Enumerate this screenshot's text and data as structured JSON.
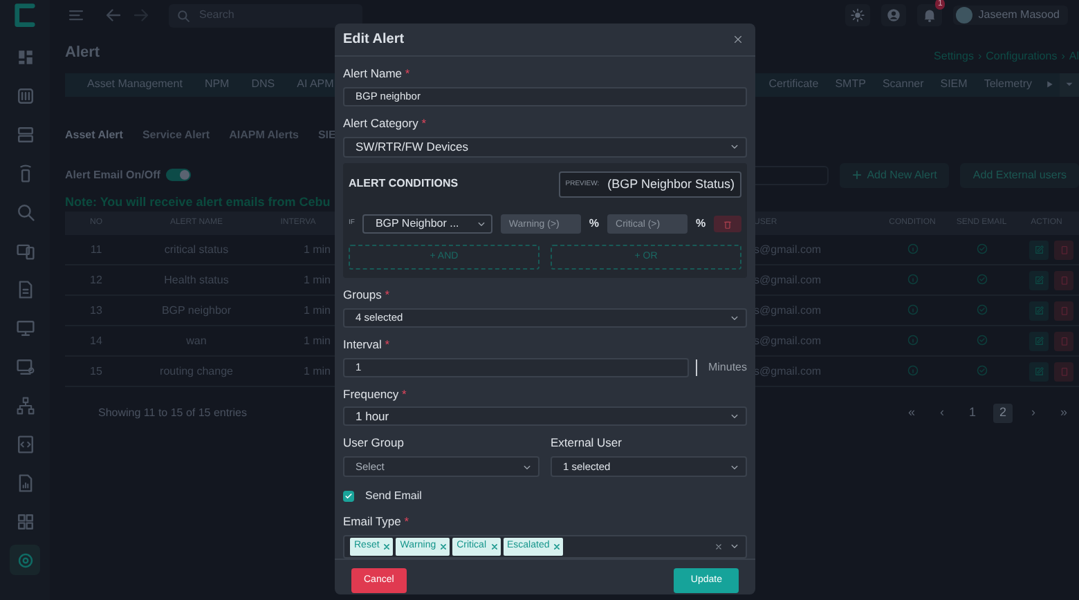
{
  "topbar": {
    "search": {
      "placeholder": "Search"
    },
    "notification_count": "1",
    "user_name": "Jaseem Masood"
  },
  "sidebar": {
    "items": [
      {
        "selected": false
      },
      {
        "selected": false
      },
      {
        "selected": false
      },
      {
        "selected": false
      },
      {
        "selected": false
      },
      {
        "selected": false
      },
      {
        "selected": false
      },
      {
        "selected": false
      },
      {
        "selected": false
      },
      {
        "selected": false
      },
      {
        "selected": false
      },
      {
        "selected": false
      },
      {
        "selected": false
      },
      {
        "selected": true
      }
    ]
  },
  "page": {
    "title": "Alert",
    "breadcrumb": [
      "Settings",
      "›",
      "Configurations",
      "›",
      "Al"
    ]
  },
  "module_tabs": {
    "left": [
      {
        "label": "Asset Management",
        "selected": false
      },
      {
        "label": "NPM",
        "selected": false
      },
      {
        "label": "DNS",
        "selected": false
      },
      {
        "label": "AI APM",
        "selected": false
      }
    ],
    "right": [
      {
        "label": "Certificate",
        "selected": false
      },
      {
        "label": "SMTP",
        "selected": false
      },
      {
        "label": "Scanner",
        "selected": false
      },
      {
        "label": "SIEM",
        "selected": false
      },
      {
        "label": "Telemetry",
        "selected": false
      }
    ]
  },
  "alert_tabs": [
    {
      "label": "Asset Alert",
      "selected": true
    },
    {
      "label": "Service Alert",
      "selected": false
    },
    {
      "label": "AIAPM Alerts",
      "selected": false
    },
    {
      "label": "SIE",
      "selected": false
    }
  ],
  "email_toggle": {
    "label": "Alert Email On/Off",
    "on": true
  },
  "buttons": [
    "Add New Alert",
    "Add External users"
  ],
  "note": "Note: You will receive alert emails from Cebu",
  "table": {
    "columns": [
      "NO",
      "ALERT NAME",
      "INTERVA",
      "USER",
      "CONDITION",
      "SEND EMAIL",
      "ACTION"
    ],
    "rows": [
      {
        "no": "11",
        "alert_name": "critical status",
        "interval": "1 min",
        "user": "s@gmail.com"
      },
      {
        "no": "12",
        "alert_name": "Health status",
        "interval": "1 min",
        "user": "s@gmail.com"
      },
      {
        "no": "13",
        "alert_name": "BGP neighbor",
        "interval": "1 min",
        "user": "s@gmail.com"
      },
      {
        "no": "14",
        "alert_name": "wan",
        "interval": "1 min",
        "user": "s@gmail.com"
      },
      {
        "no": "15",
        "alert_name": "routing change",
        "interval": "1 min",
        "user": "s@gmail.com"
      }
    ]
  },
  "entries_info": "Showing 11 to 15 of 15 entries",
  "pagination": [
    {
      "label": "«",
      "selected": false
    },
    {
      "label": "‹",
      "selected": false
    },
    {
      "label": "1",
      "selected": false
    },
    {
      "label": "2",
      "selected": true
    },
    {
      "label": "›",
      "selected": false
    },
    {
      "label": "»",
      "selected": false
    }
  ],
  "dialog": {
    "title": "Edit Alert",
    "alert_name": {
      "label": "Alert Name",
      "required_mark": "*",
      "value": "BGP neighbor"
    },
    "alert_category": {
      "label": "Alert Category",
      "required_mark": "*",
      "value": "SW/RTR/FW Devices"
    },
    "conditions": {
      "title": "ALERT CONDITIONS",
      "preview_label": "PREVIEW:",
      "preview": "(BGP Neighbor Status)",
      "rows": [
        {
          "prefix": "IF",
          "metric": "BGP Neighbor ...",
          "warning_placeholder": "Warning (>)",
          "warning_unit": "%",
          "critical_placeholder": "Critical (>)",
          "critical_unit": "%"
        }
      ],
      "add_buttons": [
        "+  AND",
        "+  OR"
      ]
    },
    "groups": {
      "label": "Groups",
      "required_mark": "*",
      "value": "4 selected"
    },
    "interval": {
      "label": "Interval",
      "required_mark": "*",
      "value": "1",
      "unit": "Minutes"
    },
    "frequency": {
      "label": "Frequency",
      "required_mark": "*",
      "value": "1 hour"
    },
    "user_group": {
      "label": "User Group",
      "placeholder": "Select"
    },
    "external_user": {
      "label": "External User",
      "value": "1 selected"
    },
    "send_email": {
      "label": "Send Email",
      "checked": true
    },
    "email_type": {
      "label": "Email Type",
      "required_mark": "*",
      "tags": [
        "Reset",
        "Warning",
        "Critical",
        "Escalated"
      ]
    },
    "cancel": "Cancel",
    "update": "Update"
  }
}
